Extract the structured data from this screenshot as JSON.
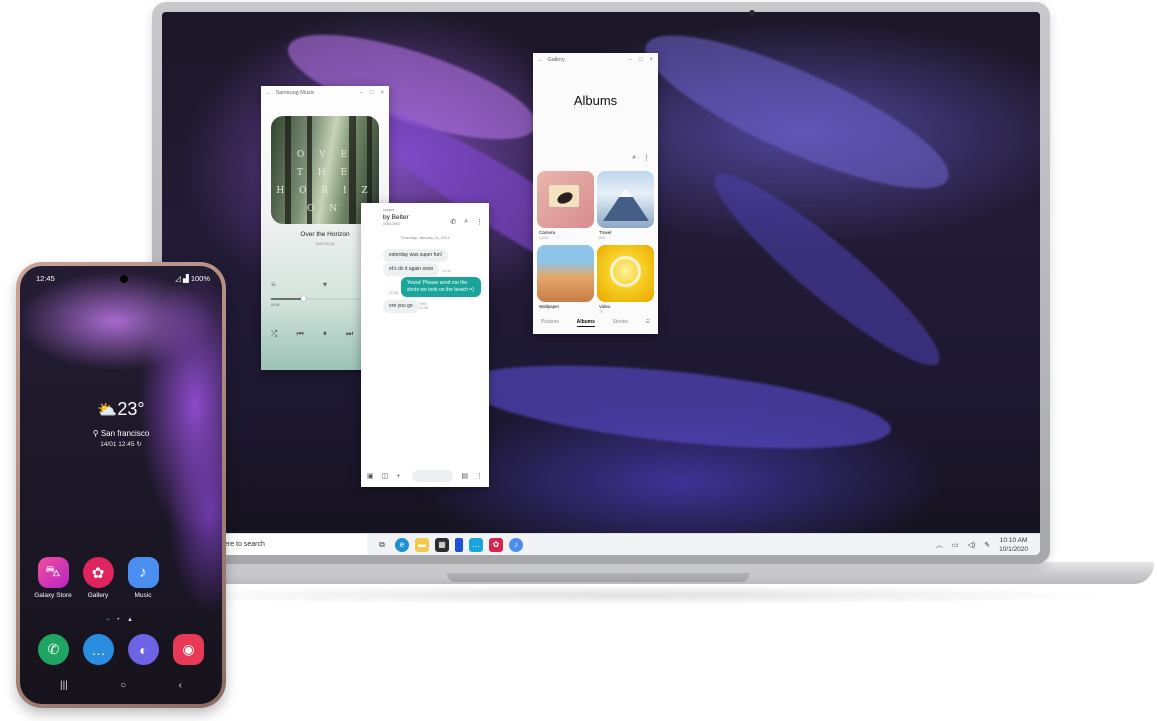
{
  "laptop": {
    "taskbar": {
      "search_text": "ere to search",
      "tray_icons": [
        "chevron-up-icon",
        "battery-icon",
        "speaker-icon",
        "pen-icon"
      ],
      "clock_time": "10:10 AM",
      "clock_date": "10/1/2020",
      "pinned_apps": [
        "task-view-icon",
        "edge-icon",
        "file-explorer-icon",
        "store-icon",
        "phone-icon",
        "messages-icon",
        "gallery-icon",
        "music-icon"
      ]
    },
    "music_window": {
      "title": "Samsung Music",
      "album_text": [
        "O V E",
        "T H E",
        "H O R I Z O N"
      ],
      "song_title": "Over the Horizon",
      "artist": "Samsung",
      "progress": 0.3,
      "time_elapsed": "00:51",
      "time_total": "03:00"
    },
    "messages_window": {
      "title": "ssages",
      "contact": "by Belter",
      "phone_number": "0456-7890",
      "date": "Thursday, January 14, 2021",
      "bubbles": [
        {
          "dir": "in",
          "text": "esterday was super fun!"
        },
        {
          "dir": "in",
          "text": "et's do it again soon",
          "time": "12:34"
        },
        {
          "dir": "out",
          "text": "Yesss! Please send me the shots we took on the beach =)",
          "time": "12:38"
        },
        {
          "dir": "in",
          "text": "ere you go",
          "time": "Hello 12:48"
        }
      ]
    },
    "gallery_window": {
      "title": "Gallery",
      "heading": "Albums",
      "albums": [
        {
          "name": "Camera",
          "count": "1,215"
        },
        {
          "name": "Travel",
          "count": "815"
        },
        {
          "name": "Wallpaper",
          "count": ""
        },
        {
          "name": "Video",
          "count": "74"
        }
      ],
      "tabs": [
        "Pictures",
        "Albums",
        "Stories"
      ],
      "active_tab": "Albums"
    }
  },
  "phone": {
    "status_time": "12:45",
    "status_right": "100%",
    "temperature": "23°",
    "location": "San francisco",
    "datetime": "14/01 12:45",
    "home_apps": [
      {
        "name": "Galaxy Store",
        "color": "#d8356f",
        "icon": "shopping-bag-icon"
      },
      {
        "name": "Gallery",
        "color": "#e0245e",
        "icon": "flower-icon"
      },
      {
        "name": "Music",
        "color": "#4a8ff0",
        "icon": "music-note-icon"
      }
    ],
    "dock": [
      {
        "name": "Phone",
        "color": "#1fa463",
        "icon": "phone-icon"
      },
      {
        "name": "Messages",
        "color": "#2a8de0",
        "icon": "chat-icon"
      },
      {
        "name": "Internet",
        "color": "#6d63e5",
        "icon": "planet-icon"
      },
      {
        "name": "Camera",
        "color": "#e83956",
        "icon": "camera-icon"
      }
    ]
  }
}
